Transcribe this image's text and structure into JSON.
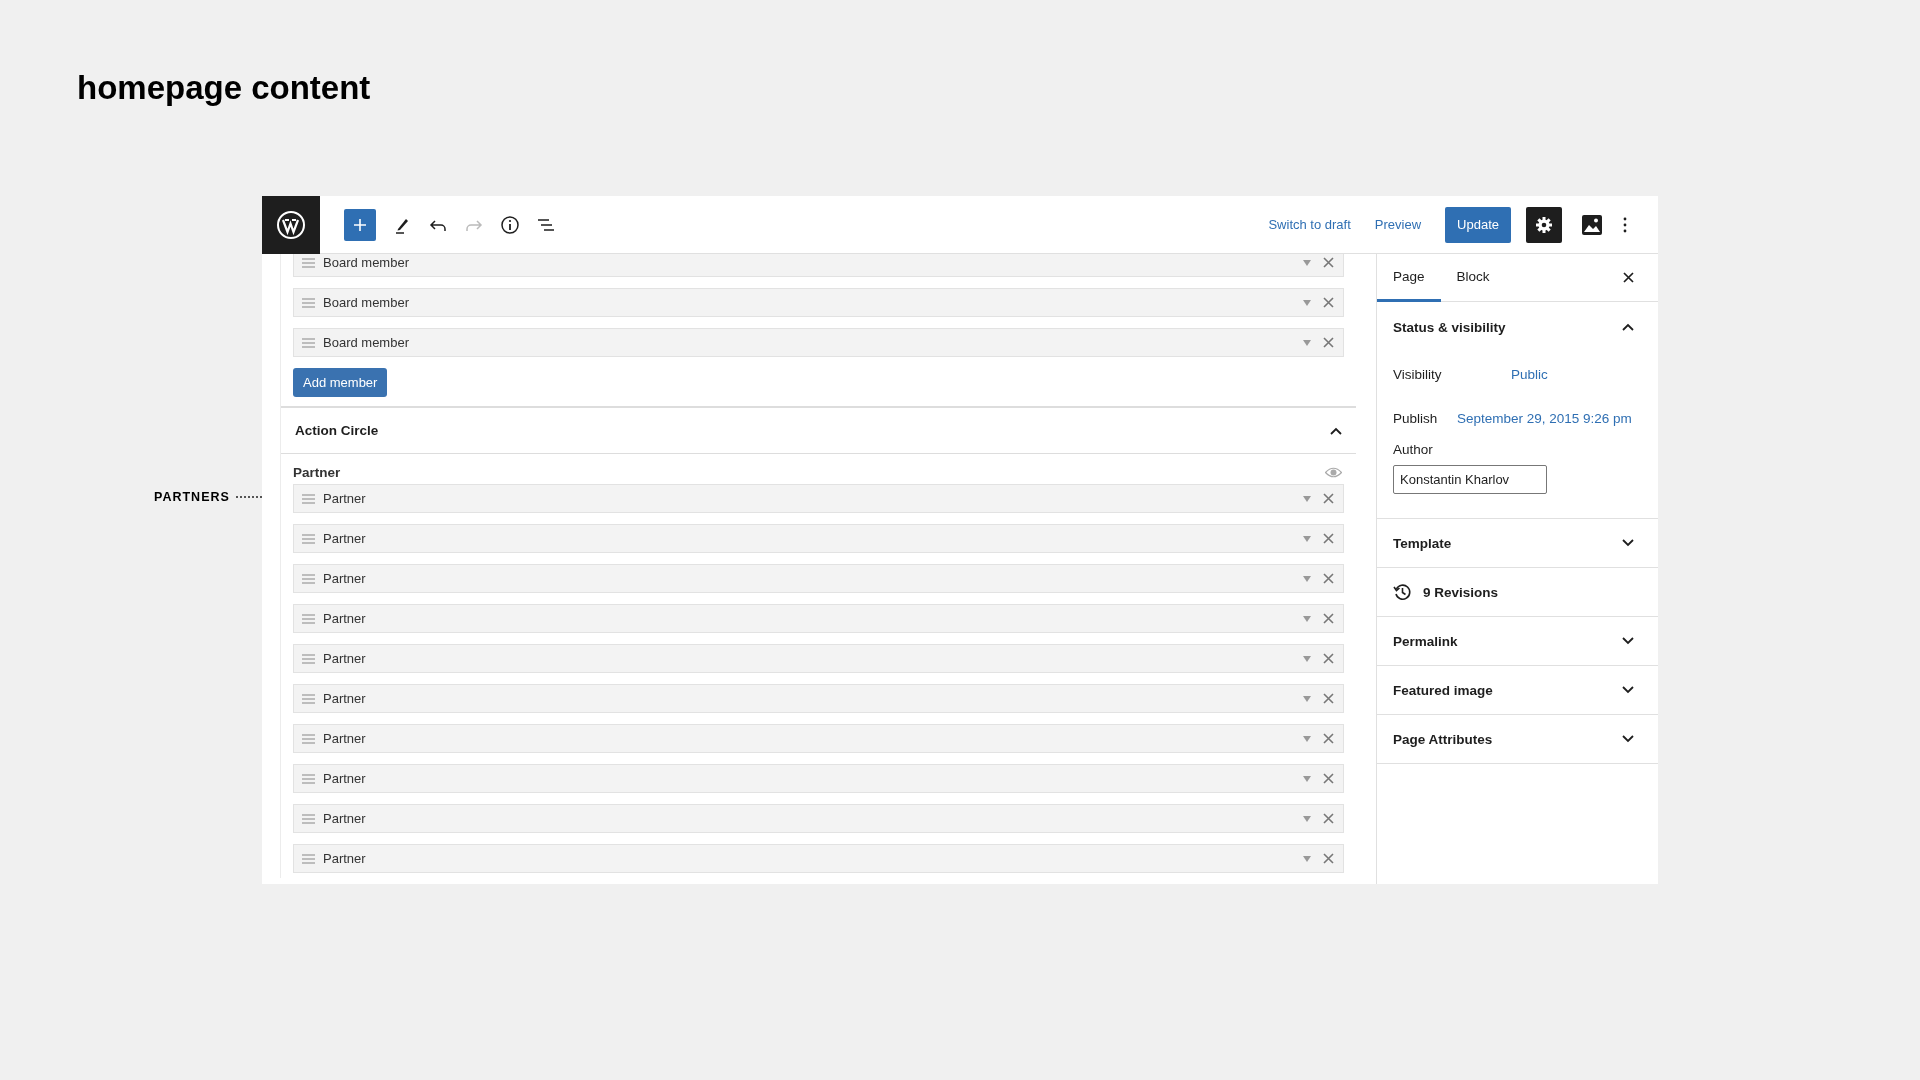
{
  "slide_title": "homepage content",
  "annotation": {
    "label": "PARTNERS"
  },
  "toolbar": {
    "switch_link": "Switch to draft",
    "preview_link": "Preview",
    "update_button": "Update",
    "settings_pressed": true
  },
  "editor": {
    "board_rows": [
      {
        "label": "Board member"
      },
      {
        "label": "Board member"
      },
      {
        "label": "Board member"
      }
    ],
    "add_button": "Add member",
    "section": {
      "title": "Action Circle",
      "expanded": true
    },
    "group_label": "Partner",
    "partner_rows": [
      {
        "label": "Partner"
      },
      {
        "label": "Partner"
      },
      {
        "label": "Partner"
      },
      {
        "label": "Partner"
      },
      {
        "label": "Partner"
      },
      {
        "label": "Partner"
      },
      {
        "label": "Partner"
      },
      {
        "label": "Partner"
      },
      {
        "label": "Partner"
      },
      {
        "label": "Partner"
      }
    ]
  },
  "sidebar": {
    "tabs": [
      {
        "label": "Page",
        "selected": true
      },
      {
        "label": "Block",
        "selected": false
      }
    ],
    "status": {
      "title": "Status & visibility",
      "expanded": true,
      "visibility_label": "Visibility",
      "visibility_value": "Public",
      "publish_label": "Publish",
      "publish_value": "September 29, 2015 9:26 pm",
      "author_label": "Author",
      "author_value": "Konstantin Kharlov"
    },
    "panels": [
      {
        "kind": "collapsible",
        "title": "Template",
        "expanded": false
      },
      {
        "kind": "revisions",
        "title": "9 Revisions"
      },
      {
        "kind": "collapsible",
        "title": "Permalink",
        "expanded": false
      },
      {
        "kind": "collapsible",
        "title": "Featured image",
        "expanded": false
      },
      {
        "kind": "collapsible",
        "title": "Page Attributes",
        "expanded": false
      }
    ]
  }
}
